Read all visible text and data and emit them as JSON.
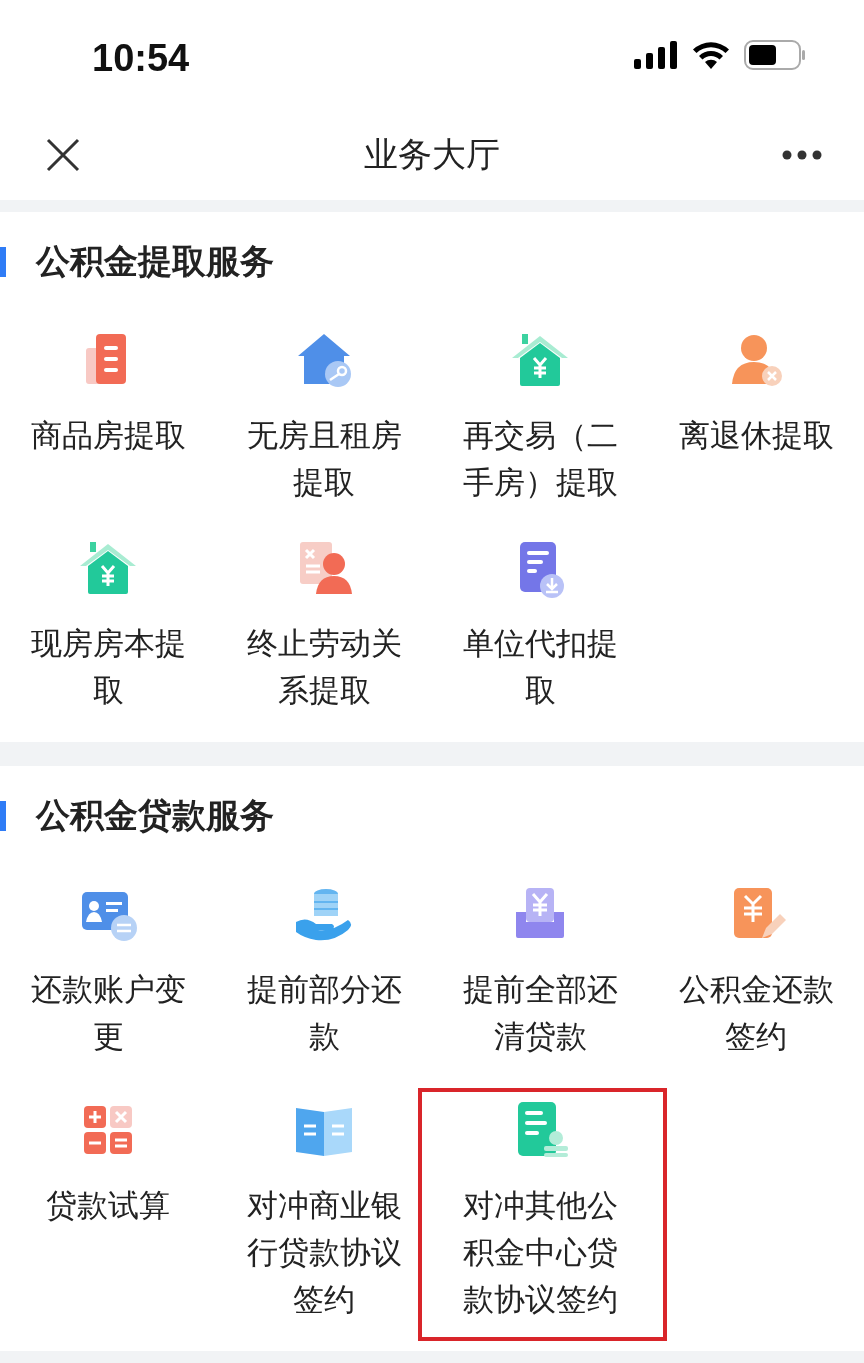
{
  "status_bar": {
    "time": "10:54"
  },
  "nav_bar": {
    "title": "业务大厅"
  },
  "sections": [
    {
      "title": "公积金提取服务",
      "items": [
        {
          "label": "商品房提取",
          "kind": "building",
          "highlighted": false
        },
        {
          "label": "无房且租房提取",
          "kind": "house-key",
          "highlighted": false
        },
        {
          "label": "再交易（二手房）提取",
          "kind": "house-yuan",
          "highlighted": false
        },
        {
          "label": "离退休提取",
          "kind": "person-x",
          "highlighted": false
        },
        {
          "label": "现房房本提取",
          "kind": "house-yuan",
          "highlighted": false
        },
        {
          "label": "终止劳动关系提取",
          "kind": "person-doc",
          "highlighted": false
        },
        {
          "label": "单位代扣提取",
          "kind": "doc-download",
          "highlighted": false
        }
      ]
    },
    {
      "title": "公积金贷款服务",
      "items": [
        {
          "label": "还款账户变更",
          "kind": "card-swap",
          "highlighted": false
        },
        {
          "label": "提前部分还款",
          "kind": "hand-coins",
          "highlighted": false
        },
        {
          "label": "提前全部还清贷款",
          "kind": "tray-yuan",
          "highlighted": false
        },
        {
          "label": "公积金还款签约",
          "kind": "doc-pen",
          "highlighted": false
        },
        {
          "label": "贷款试算",
          "kind": "calculator",
          "highlighted": false
        },
        {
          "label": "对冲商业银行贷款协议签约",
          "kind": "book",
          "highlighted": false
        },
        {
          "label": "对冲其他公积金中心贷款协议签约",
          "kind": "doc-person",
          "highlighted": true
        }
      ]
    }
  ]
}
